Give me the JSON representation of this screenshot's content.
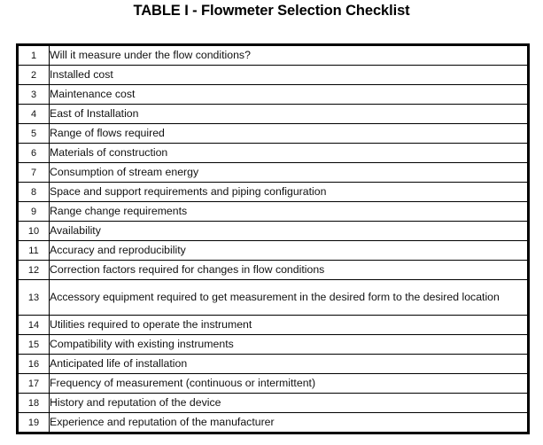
{
  "title": "TABLE I - Flowmeter Selection Checklist",
  "rows": [
    {
      "num": "1",
      "text": "Will it measure under the flow conditions?"
    },
    {
      "num": "2",
      "text": "Installed cost"
    },
    {
      "num": "3",
      "text": "Maintenance cost"
    },
    {
      "num": "4",
      "text": "East of Installation"
    },
    {
      "num": "5",
      "text": "Range of flows required"
    },
    {
      "num": "6",
      "text": "Materials of construction"
    },
    {
      "num": "7",
      "text": "Consumption of stream energy"
    },
    {
      "num": "8",
      "text": "Space and support requirements and piping configuration"
    },
    {
      "num": "9",
      "text": "Range change requirements"
    },
    {
      "num": "10",
      "text": "Availability"
    },
    {
      "num": "11",
      "text": "Accuracy and reproducibility"
    },
    {
      "num": "12",
      "text": "Correction factors required for changes in flow conditions"
    },
    {
      "num": "13",
      "text": "Accessory equipment required to get measurement in the desired form to the desired location"
    },
    {
      "num": "14",
      "text": "Utilities required to operate the instrument"
    },
    {
      "num": "15",
      "text": "Compatibility with existing instruments"
    },
    {
      "num": "16",
      "text": "Anticipated life of installation"
    },
    {
      "num": "17",
      "text": "Frequency of measurement (continuous or intermittent)"
    },
    {
      "num": "18",
      "text": "History and reputation of the device"
    },
    {
      "num": "19",
      "text": "Experience and reputation of the manufacturer"
    }
  ]
}
